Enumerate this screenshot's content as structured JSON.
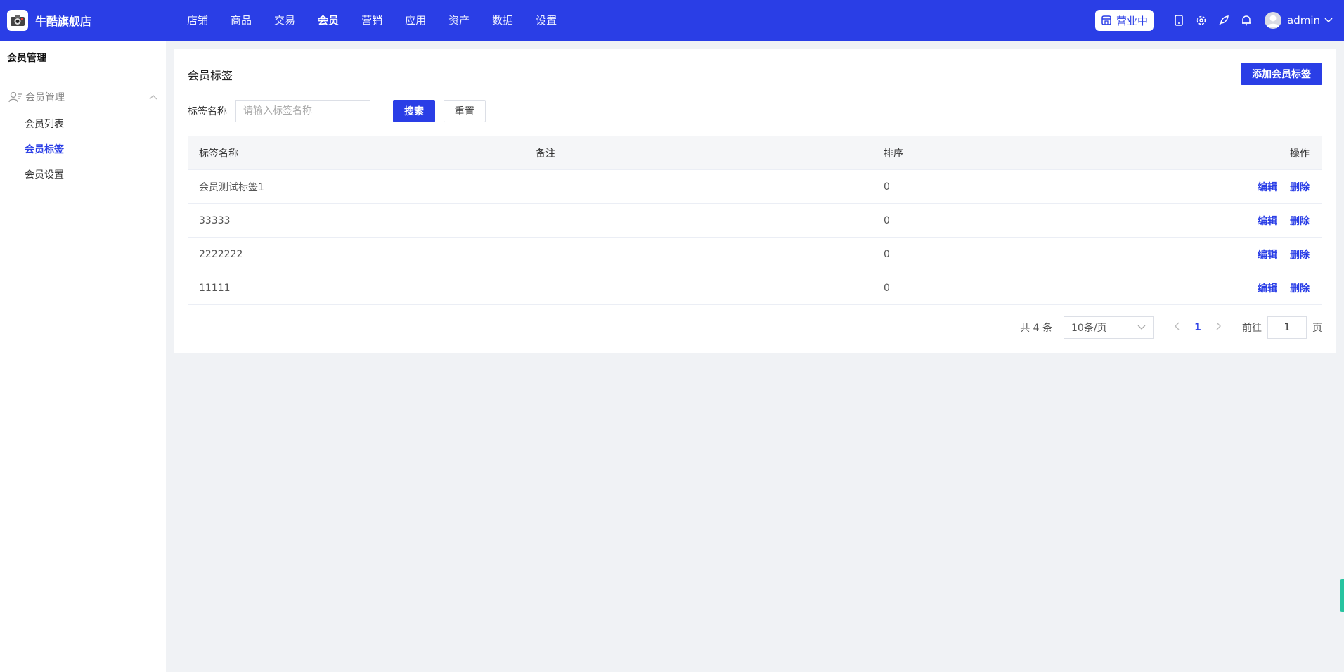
{
  "brand": {
    "name": "牛酷旗舰店"
  },
  "topnav": {
    "items": [
      {
        "label": "店铺"
      },
      {
        "label": "商品"
      },
      {
        "label": "交易"
      },
      {
        "label": "会员",
        "active": true
      },
      {
        "label": "营销"
      },
      {
        "label": "应用"
      },
      {
        "label": "资产"
      },
      {
        "label": "数据"
      },
      {
        "label": "设置"
      }
    ]
  },
  "header": {
    "status_label": "营业中",
    "username": "admin"
  },
  "sidebar": {
    "title": "会员管理",
    "group_label": "会员管理",
    "items": [
      {
        "label": "会员列表"
      },
      {
        "label": "会员标签",
        "active": true
      },
      {
        "label": "会员设置"
      }
    ]
  },
  "main": {
    "title": "会员标签",
    "add_button": "添加会员标签",
    "filter": {
      "label": "标签名称",
      "placeholder": "请输入标签名称",
      "value": "",
      "search_button": "搜索",
      "reset_button": "重置"
    },
    "table": {
      "columns": [
        "标签名称",
        "备注",
        "排序",
        "操作"
      ],
      "rows": [
        {
          "name": "会员测试标签1",
          "remark": "",
          "sort": "0"
        },
        {
          "name": "33333",
          "remark": "",
          "sort": "0"
        },
        {
          "name": "2222222",
          "remark": "",
          "sort": "0"
        },
        {
          "name": "11111",
          "remark": "",
          "sort": "0"
        }
      ],
      "edit_label": "编辑",
      "delete_label": "删除"
    },
    "pagination": {
      "total_text": "共 4 条",
      "page_size": "10条/页",
      "current_page": "1",
      "goto_prefix": "前往",
      "goto_value": "1",
      "goto_suffix": "页"
    }
  },
  "colors": {
    "primary": "#2a3ee6",
    "page_bg": "#f0f2f5",
    "edge_tab": "#27c4a0"
  }
}
